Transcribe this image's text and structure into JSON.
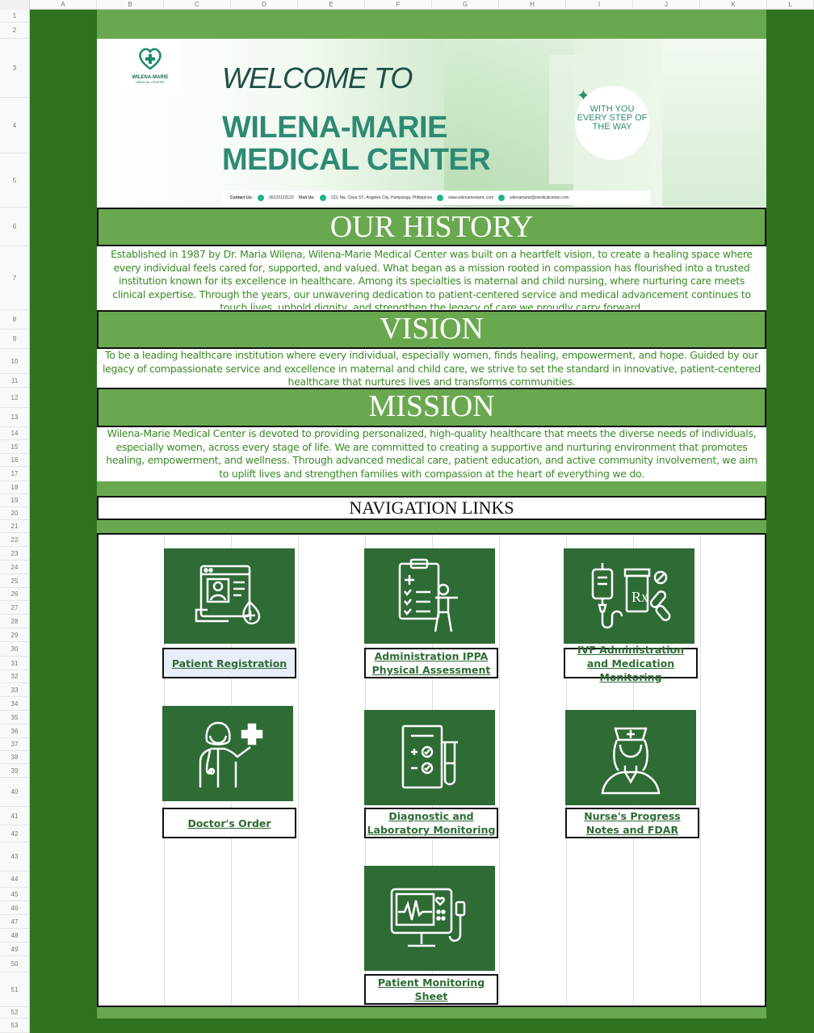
{
  "sheet": {
    "columns": [
      "A",
      "B",
      "C",
      "D",
      "E",
      "F",
      "G",
      "H",
      "I",
      "J",
      "K",
      "L"
    ],
    "rows": [
      "1",
      "2",
      "3",
      "4",
      "5",
      "6",
      "7",
      "8",
      "9",
      "10",
      "11",
      "12",
      "13",
      "14",
      "15",
      "16",
      "17",
      "18",
      "19",
      "20",
      "21",
      "22",
      "23",
      "24",
      "25",
      "26",
      "27",
      "28",
      "29",
      "30",
      "31",
      "32",
      "33",
      "34",
      "35",
      "36",
      "37",
      "38",
      "39",
      "40",
      "41",
      "42",
      "43",
      "44",
      "45",
      "46",
      "47",
      "48",
      "49",
      "50",
      "51",
      "52",
      "53"
    ]
  },
  "banner": {
    "logo_name": "WILENA-MARIE",
    "logo_sub": "MEDICAL CENTER",
    "welcome": "WELCOME TO",
    "center_name": "WILENA-MARIE MEDICAL CENTER",
    "tagline": "WITH YOU EVERY STEP OF THE WAY",
    "contact_label": "Contact Us:",
    "phone": "09123123123",
    "visit_label": "Visit Us:",
    "address": "123, Ma. Clara ST., Angeles City, Pampanga, Philippines",
    "website": "www.wilenamedamc.com",
    "email": "wilenamarie@medicalcenter.com"
  },
  "history": {
    "title": "OUR HISTORY",
    "text": "Established in 1987 by Dr. Maria Wilena, Wilena-Marie Medical Center was built on a heartfelt vision, to create a healing space where every individual feels cared for, supported, and valued. What began as a mission rooted in compassion has flourished into a trusted institution known for its excellence in healthcare. Among its specialties is maternal and child nursing, where nurturing care meets clinical expertise. Through the years, our unwavering dedication to patient-centered service and medical advancement continues to touch lives, uphold dignity, and strengthen the legacy of care we proudly carry forward."
  },
  "vision": {
    "title": "VISION",
    "text": "To be a leading healthcare institution where every individual, especially women, finds healing, empowerment, and hope. Guided by our legacy of compassionate service and excellence in maternal and child care, we strive to set the standard in innovative, patient-centered healthcare that nurtures lives and transforms communities."
  },
  "mission": {
    "title": "MISSION",
    "text": "Wilena-Marie Medical Center is devoted to providing personalized, high-quality healthcare that meets the diverse needs of individuals, especially women, across every stage of life. We are committed to creating a supportive and nurturing environment that promotes healing, empowerment, and wellness. Through advanced medical care, patient education, and active community involvement, we aim to uplift lives and strengthen families with compassion at the heart of everything we do."
  },
  "nav": {
    "title": "NAVIGATION LINKS",
    "links": [
      {
        "label": "Patient Registration",
        "icon": "patient-registration-icon"
      },
      {
        "label": "Administration IPPA Physical Assessment",
        "icon": "clipboard-assessment-icon"
      },
      {
        "label": "IVF Administration and Medication Monitoring",
        "icon": "iv-medication-icon"
      },
      {
        "label": "Doctor's Order",
        "icon": "doctor-icon"
      },
      {
        "label": "Diagnostic and Laboratory Monitoring",
        "icon": "lab-test-icon"
      },
      {
        "label": "Nurse's Progress Notes and FDAR",
        "icon": "nurse-icon"
      },
      {
        "label": "Patient Monitoring Sheet",
        "icon": "patient-monitor-icon"
      }
    ]
  },
  "colors": {
    "dark_green": "#2f7320",
    "light_green": "#6aa84f",
    "tile_green": "#2e6b35",
    "text_green": "#3a8a25"
  }
}
